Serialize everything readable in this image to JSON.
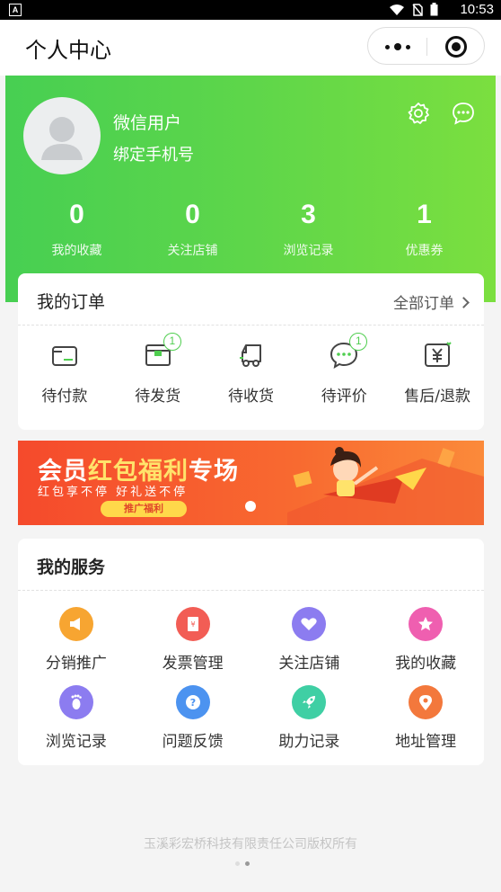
{
  "status_bar": {
    "time": "10:53"
  },
  "nav": {
    "title": "个人中心"
  },
  "user": {
    "name": "微信用户",
    "bind_phone": "绑定手机号"
  },
  "stats": [
    {
      "value": "0",
      "label": "我的收藏"
    },
    {
      "value": "0",
      "label": "关注店铺"
    },
    {
      "value": "3",
      "label": "浏览记录"
    },
    {
      "value": "1",
      "label": "优惠券"
    }
  ],
  "orders": {
    "title": "我的订单",
    "all_label": "全部订单",
    "items": [
      {
        "label": "待付款",
        "icon": "wallet-icon",
        "badge": ""
      },
      {
        "label": "待发货",
        "icon": "package-icon",
        "badge": "1"
      },
      {
        "label": "待收货",
        "icon": "truck-icon",
        "badge": ""
      },
      {
        "label": "待评价",
        "icon": "comment-icon",
        "badge": "1"
      },
      {
        "label": "售后/退款",
        "icon": "refund-icon",
        "badge": ""
      }
    ]
  },
  "banner": {
    "title_part1": "会员",
    "title_part2": "红包福利",
    "title_part3": "专场",
    "subtitle": "红包享不停 好礼送不停",
    "tag": "推广福利"
  },
  "services": {
    "title": "我的服务",
    "items": [
      {
        "label": "分销推广",
        "icon": "megaphone-icon",
        "color": "#f7a531"
      },
      {
        "label": "发票管理",
        "icon": "invoice-icon",
        "color": "#f25d55"
      },
      {
        "label": "关注店铺",
        "icon": "heart-icon",
        "color": "#8c7cf0"
      },
      {
        "label": "我的收藏",
        "icon": "star-icon",
        "color": "#ef5fb0"
      },
      {
        "label": "浏览记录",
        "icon": "footprint-icon",
        "color": "#8c7cf0"
      },
      {
        "label": "问题反馈",
        "icon": "question-icon",
        "color": "#4c93f0"
      },
      {
        "label": "助力记录",
        "icon": "rocket-icon",
        "color": "#3fcfa4"
      },
      {
        "label": "地址管理",
        "icon": "location-icon",
        "color": "#f3783c"
      }
    ]
  },
  "footer": {
    "copyright": "玉溪彩宏桥科技有限责任公司版权所有"
  },
  "colors": {
    "brand_green": "#4fce4f",
    "banner_red": "#f54a2c"
  }
}
